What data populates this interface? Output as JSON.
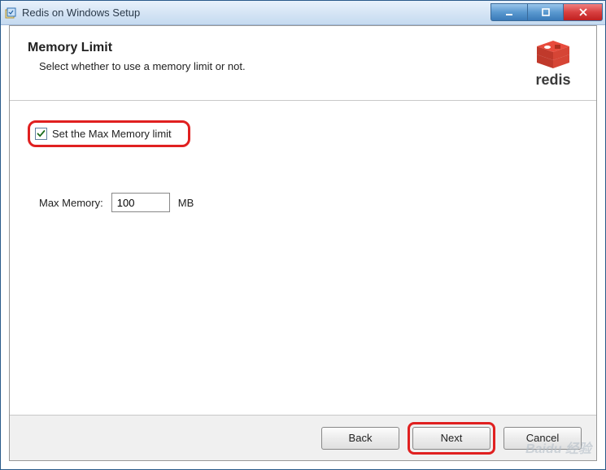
{
  "titlebar": {
    "title": "Redis on Windows Setup"
  },
  "header": {
    "title": "Memory Limit",
    "subtitle": "Select whether to use a memory limit or not.",
    "logo_text": "redis"
  },
  "body": {
    "checkbox_label": "Set the Max Memory limit",
    "checkbox_checked": true,
    "memory_label": "Max Memory:",
    "memory_value": "100",
    "memory_unit": "MB"
  },
  "footer": {
    "back": "Back",
    "next": "Next",
    "cancel": "Cancel"
  },
  "highlights": {
    "checkbox": true,
    "next": true
  },
  "colors": {
    "highlight": "#e02020",
    "redis_red": "#d82c20"
  },
  "watermark": "Baidu 经验"
}
